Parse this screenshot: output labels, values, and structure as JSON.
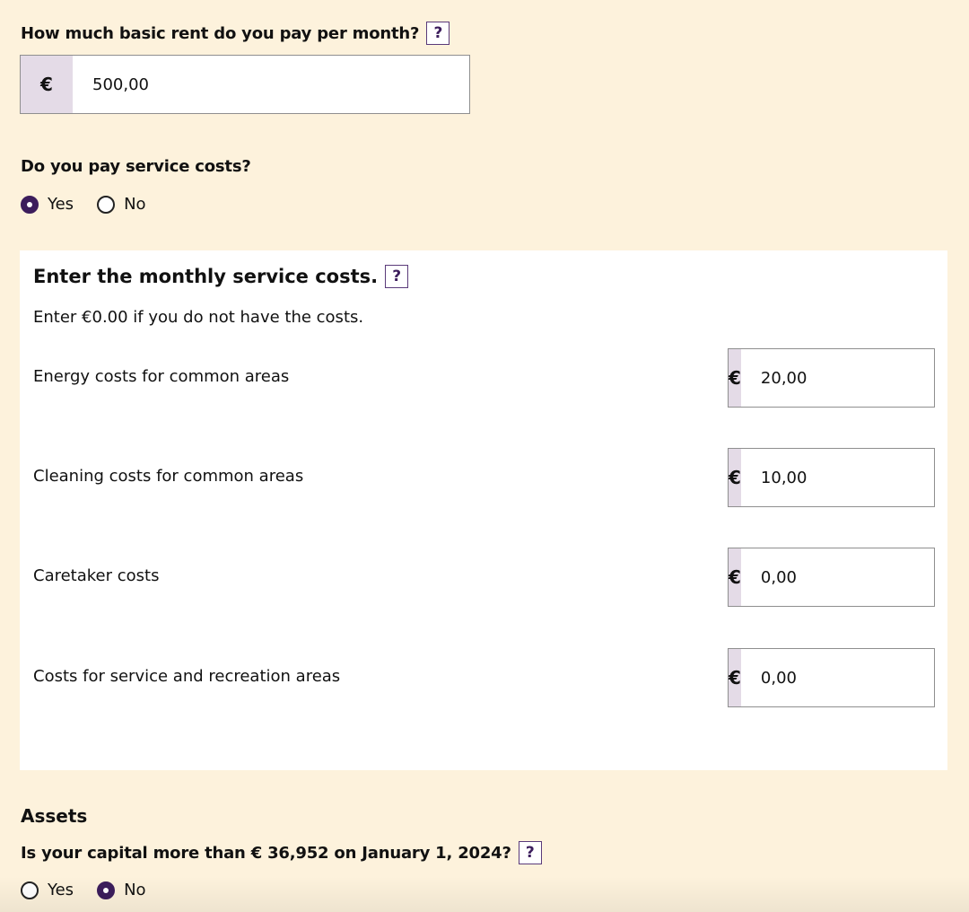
{
  "rent": {
    "question": "How much basic rent do you pay per month?",
    "help": "?",
    "currency": "€",
    "value": "500,00"
  },
  "service_costs_question": {
    "question": "Do you pay service costs?",
    "options": [
      {
        "label": "Yes",
        "checked": true
      },
      {
        "label": "No",
        "checked": false
      }
    ]
  },
  "service_costs_panel": {
    "title": "Enter the monthly service costs.",
    "help": "?",
    "hint": "Enter €0.00 if you do not have the costs.",
    "rows": [
      {
        "label": "Energy costs for common areas",
        "currency": "€",
        "value": "20,00"
      },
      {
        "label": "Cleaning costs for common areas",
        "currency": "€",
        "value": "10,00"
      },
      {
        "label": "Caretaker costs",
        "currency": "€",
        "value": "0,00"
      },
      {
        "label": "Costs for service and recreation areas",
        "currency": "€",
        "value": "0,00"
      }
    ]
  },
  "assets": {
    "title": "Assets",
    "question": "Is your capital more than € 36,952 on January 1, 2024?",
    "help": "?",
    "options": [
      {
        "label": "Yes",
        "checked": false
      },
      {
        "label": "No",
        "checked": true
      }
    ]
  },
  "colors": {
    "page_bg": "#fdf2dc",
    "accent": "#3c1d5c",
    "prefix_bg": "#e4dbe7"
  }
}
